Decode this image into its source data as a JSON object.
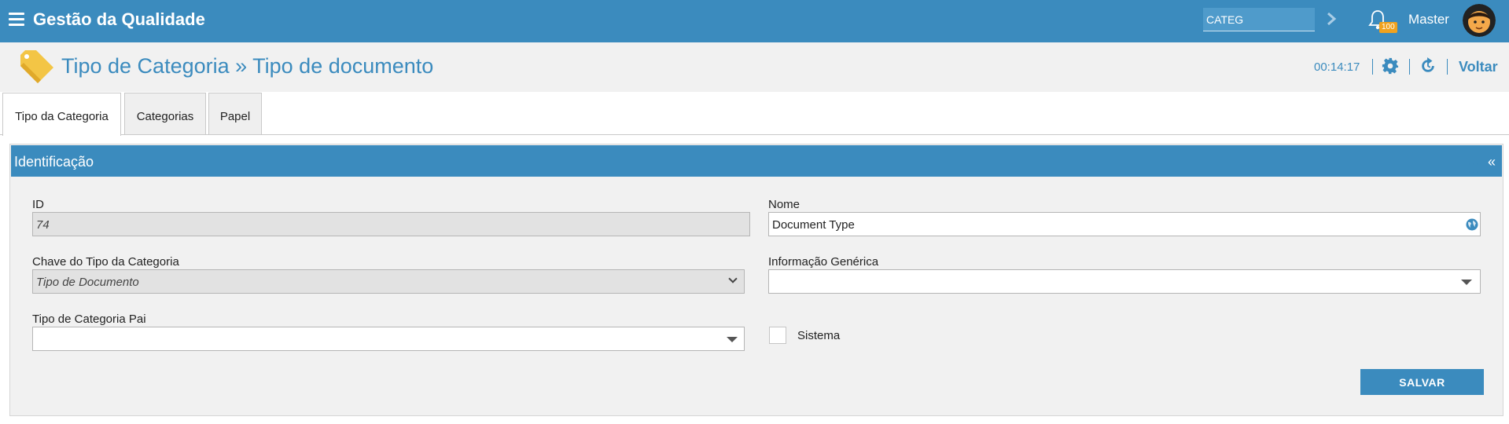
{
  "app": {
    "title": "Gestão da Qualidade"
  },
  "topbar": {
    "search_value": "CATEG",
    "notifications_count": "100",
    "user_name": "Master"
  },
  "header": {
    "title": "Tipo de Categoria » Tipo de documento",
    "timer": "00:14:17",
    "back_label": "Voltar"
  },
  "tabs": [
    {
      "label": "Tipo da Categoria",
      "active": true
    },
    {
      "label": "Categorias",
      "active": false
    },
    {
      "label": "Papel",
      "active": false
    }
  ],
  "panel": {
    "title": "Identificação",
    "collapse_symbol": "«"
  },
  "form": {
    "id_label": "ID",
    "id_value": "74",
    "nome_label": "Nome",
    "nome_value": "Document Type",
    "chave_label": "Chave do Tipo da Categoria",
    "chave_value": "Tipo de Documento",
    "info_label": "Informação Genérica",
    "info_value": "",
    "pai_label": "Tipo de Categoria Pai",
    "pai_value": "",
    "sistema_label": "Sistema",
    "save_label": "SALVAR"
  },
  "colors": {
    "primary": "#3b8bbe",
    "badge": "#f0a21e",
    "tag_icon": "#f3c545"
  }
}
